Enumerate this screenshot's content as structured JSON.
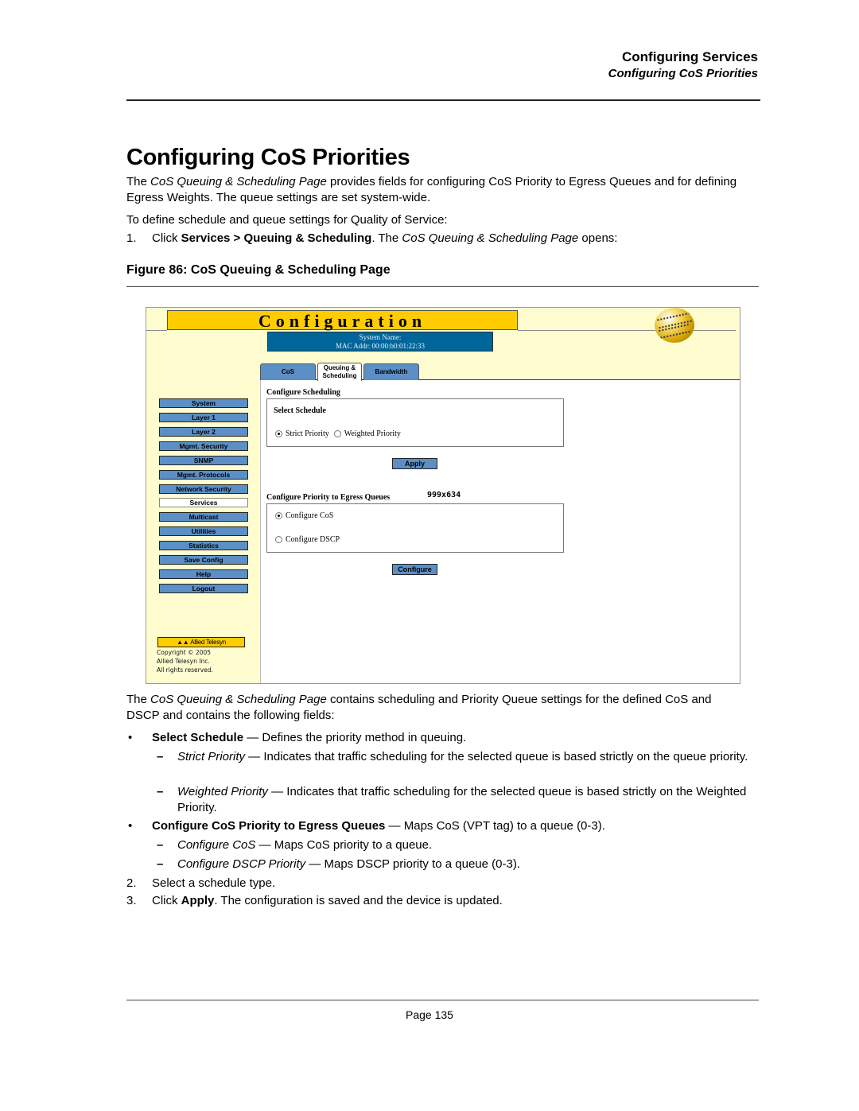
{
  "running_header": {
    "chapter": "Configuring Services",
    "section": "Configuring CoS Priorities"
  },
  "title": "Configuring CoS Priorities",
  "intro": {
    "p1_italic": "CoS Queuing & Scheduling Page",
    "p1_pre": "The ",
    "p1_post": " provides fields for configuring CoS Priority to Egress Queues and for defining Egress Weights. The queue settings are set system-wide.",
    "p2": "To define schedule and queue settings for Quality of Service:",
    "step1": {
      "num": "1.",
      "pre": "Click ",
      "bold1": "Services > Queuing & Scheduling",
      "mid": ". The ",
      "italic": "CoS Queuing & Scheduling Page",
      "post": " opens:"
    }
  },
  "figure": {
    "caption": "Figure 86:  CoS Queuing & Scheduling Page",
    "screenshot": {
      "banner_title": "Configuration",
      "system_name_label": "System Name:",
      "mac_addr": "MAC Addr:  00:00:b0:01:22:33",
      "tabs": [
        {
          "label": "CoS",
          "active": false
        },
        {
          "label": "Queuing & Scheduling",
          "active": true
        },
        {
          "label": "Bandwidth",
          "active": false
        }
      ],
      "nav": [
        {
          "label": "System",
          "active": false
        },
        {
          "label": "Layer 1",
          "active": false
        },
        {
          "label": "Layer 2",
          "active": false
        },
        {
          "label": "Mgmt. Security",
          "active": false
        },
        {
          "label": "SNMP",
          "active": false
        },
        {
          "label": "Mgmt. Protocols",
          "active": false
        },
        {
          "label": "Network Security",
          "active": false
        },
        {
          "label": "Services",
          "active": true
        },
        {
          "label": "Multicast",
          "active": false
        },
        {
          "label": "Utilities",
          "active": false
        },
        {
          "label": "Statistics",
          "active": false
        },
        {
          "label": "Save Config",
          "active": false
        },
        {
          "label": "Help",
          "active": false
        },
        {
          "label": "Logout",
          "active": false
        }
      ],
      "logo_text": "Allied Telesyn",
      "copyright": [
        "Copyright © 2005",
        "Allied Telesyn Inc.",
        "All rights reserved."
      ],
      "configure_scheduling": {
        "section_label": "Configure Scheduling",
        "panel_title": "Select Schedule",
        "options": [
          {
            "label": "Strict Priority",
            "selected": true
          },
          {
            "label": "Weighted Priority",
            "selected": false
          }
        ],
        "apply_label": "Apply"
      },
      "configure_priority": {
        "section_label": "Configure Priority to Egress Queues",
        "dims_text": "999x634",
        "options": [
          {
            "label": "Configure CoS",
            "selected": true
          },
          {
            "label": "Configure DSCP",
            "selected": false
          }
        ],
        "configure_label": "Configure"
      }
    }
  },
  "description": {
    "pre": "The ",
    "italic": "CoS Queuing & Scheduling Page",
    "post": " contains scheduling and Priority Queue settings for the defined CoS and DSCP and contains the following fields:"
  },
  "fields": [
    {
      "bullet": "•",
      "bold": "Select Schedule",
      "text": " — Defines the priority method in queuing.",
      "sub": [
        {
          "dash": "–",
          "italic": "Strict Priority",
          "text": " — Indicates that traffic scheduling for the selected queue is based strictly on the queue priority."
        },
        {
          "dash": "–",
          "italic": "Weighted Priority",
          "text": " — Indicates that traffic scheduling for the selected queue is based strictly on the Weighted Priority."
        }
      ]
    },
    {
      "bullet": "•",
      "bold": "Configure CoS Priority to Egress Queues",
      "text": " — Maps CoS (VPT tag) to a queue (0-3).",
      "sub": [
        {
          "dash": "–",
          "italic": "Configure CoS",
          "text": " — Maps CoS priority to a queue."
        },
        {
          "dash": "–",
          "italic": "Configure DSCP Priority",
          "text": " — Maps DSCP priority to a queue (0-3)."
        }
      ]
    }
  ],
  "steps": [
    {
      "num": "2.",
      "pre": "Select a schedule type.",
      "bold": "",
      "post": ""
    },
    {
      "num": "3.",
      "pre": "Click ",
      "bold": "Apply",
      "post": ". The configuration is saved and the device is updated."
    }
  ],
  "footer": {
    "page": "Page 135"
  }
}
